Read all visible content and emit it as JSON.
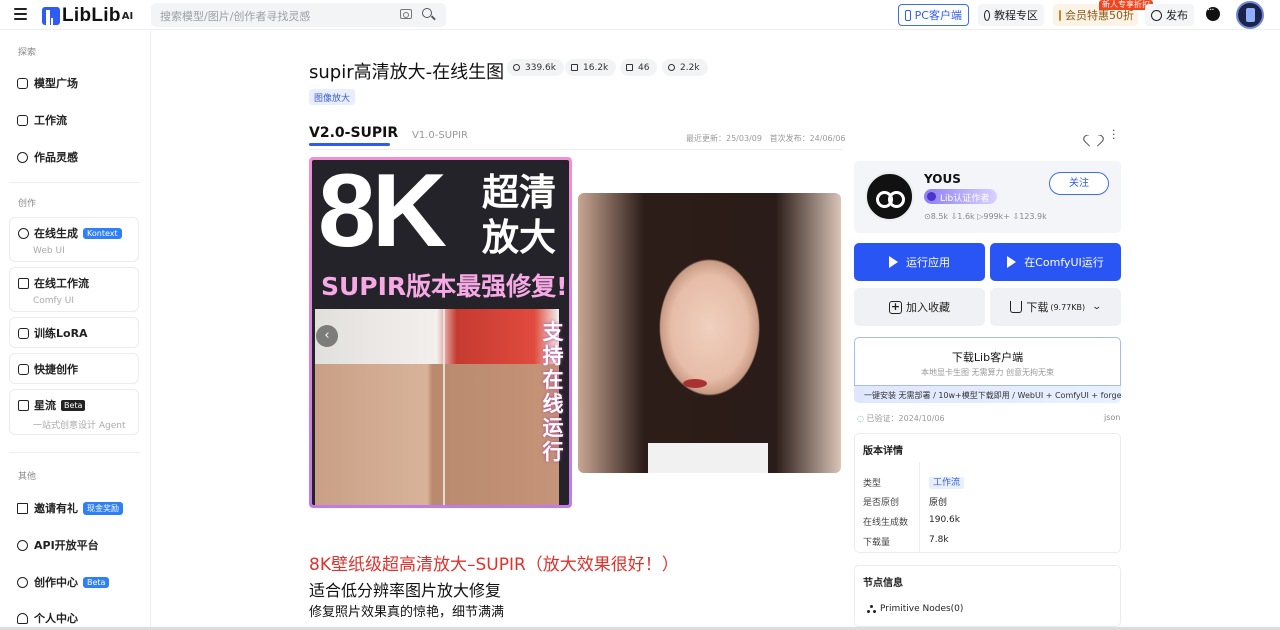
{
  "header": {
    "logo": "LibLib",
    "logo_suffix": "AI",
    "search_placeholder": "搜索模型/图片/创作者寻找灵感",
    "pc_client": "PC客户端",
    "tutorials": "教程专区",
    "vip": "会员特惠50折",
    "vip_badge": "新人专享折扣",
    "publish": "发布"
  },
  "sidebar": {
    "section_explore": "探索",
    "explore": [
      "模型广场",
      "工作流",
      "作品灵感"
    ],
    "section_create": "创作",
    "create_cards": [
      {
        "title": "在线生成",
        "tag": "Kontext",
        "sub": "Web UI"
      },
      {
        "title": "在线工作流",
        "tag": "",
        "sub": "Comfy UI"
      }
    ],
    "simple_cards": [
      "训练LoRA",
      "快捷创作"
    ],
    "star_card": {
      "title": "星流",
      "tag": "Beta",
      "sub": "一站式创意设计 Agent"
    },
    "section_other": "其他",
    "other": [
      {
        "label": "邀请有礼",
        "tag": "现金奖励"
      },
      {
        "label": "API开放平台",
        "tag": ""
      },
      {
        "label": "创作中心",
        "tag": "Beta"
      },
      {
        "label": "个人中心",
        "tag": ""
      }
    ]
  },
  "model": {
    "title": "supir高清放大-在线生图",
    "stats": {
      "runs": "339.6k",
      "downloads": "16.2k",
      "images": "46",
      "likes": "2.2k"
    },
    "category": "图像放大",
    "versions": [
      "V2.0-SUPIR",
      "V1.0-SUPIR"
    ],
    "updated": "最近更新：25/03/09",
    "published": "首次发布：24/06/06"
  },
  "poster": {
    "big": "8K",
    "side_title": "超清放大",
    "subtitle": "SUPIR版本最强修复!",
    "vertical": "支持在线运行"
  },
  "description": {
    "line1": "8K壁纸级超高清放大–SUPIR（放大效果很好！）",
    "line2": "适合低分辨率图片放大修复",
    "line3": "修复照片效果真的惊艳，细节满满"
  },
  "author": {
    "name": "YOUS",
    "badge": "Lib认证作者",
    "stats": "⊙8.5k  ⇩1.6k  ▷999k+  ⇩123.9k",
    "follow": "关注"
  },
  "actions": {
    "run_app": "运行应用",
    "run_comfy": "在ComfyUI运行",
    "favorite": "加入收藏",
    "download": "下载",
    "download_size": "(9.77KB)"
  },
  "client": {
    "title": "下载Lib客户端",
    "sub": "本地显卡生图 无需算力 创意无拘无束",
    "banner": "一键安装 无需部署 / 10w+模型下载即用 / WebUI + ComfyUI + forge"
  },
  "verified": "已验证：2024/10/06",
  "json_label": "json",
  "details": {
    "title": "版本详情",
    "rows": [
      {
        "k": "类型",
        "v": "工作流"
      },
      {
        "k": "是否原创",
        "v": "原创"
      },
      {
        "k": "在线生成数",
        "v": "190.6k"
      },
      {
        "k": "下载量",
        "v": "7.8k"
      }
    ]
  },
  "nodes": {
    "title": "节点信息",
    "item": "Primitive Nodes(0)"
  }
}
